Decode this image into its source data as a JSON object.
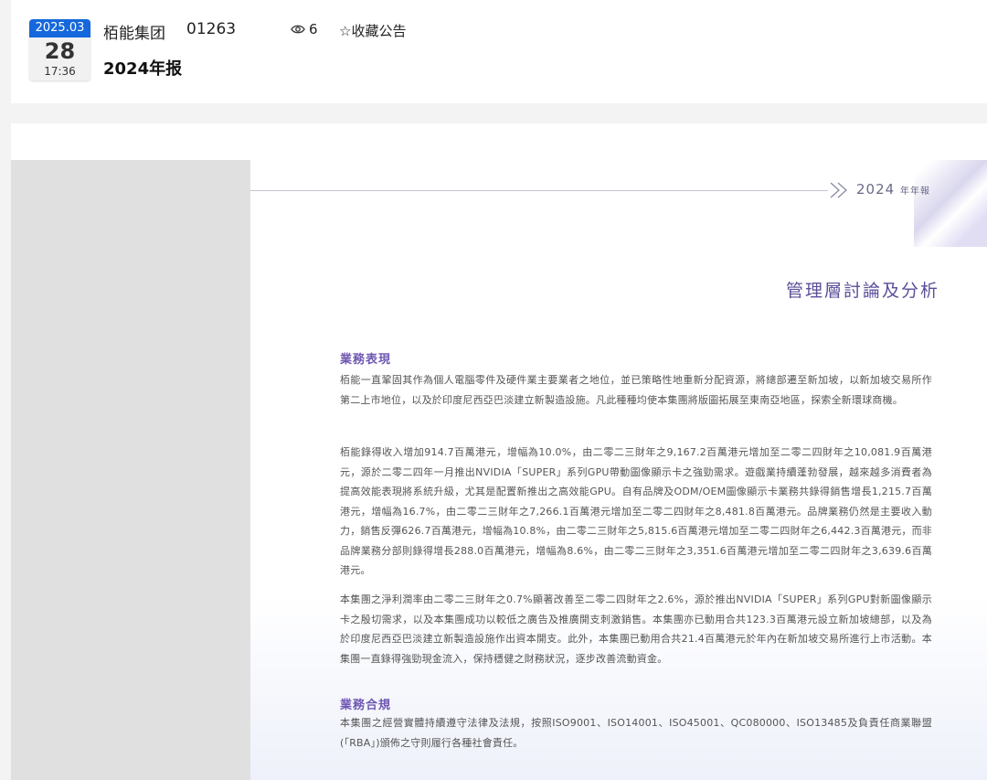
{
  "header": {
    "date_month": "2025.03",
    "date_day": "28",
    "date_time": "17:36",
    "company": "栢能集团",
    "stock_code": "01263",
    "views": "6",
    "favorite_label": "☆收藏公告",
    "title": "2024年报"
  },
  "document": {
    "year": "2024",
    "report_label": "年年報",
    "section_title": "管理層討論及分析",
    "heading1": "業務表現",
    "para1": "栢能一直鞏固其作為個人電腦零件及硬件業主要業者之地位，並已策略性地重新分配資源，將總部遷至新加坡，以新加坡交易所作第二上市地位，以及於印度尼西亞巴淡建立新製造設施。凡此種種均使本集團將版圖拓展至東南亞地區，探索全新環球商機。",
    "para2": "栢能錄得收入增加914.7百萬港元，增幅為10.0%，由二零二三財年之9,167.2百萬港元增加至二零二四財年之10,081.9百萬港元，源於二零二四年一月推出NVIDIA「SUPER」系列GPU帶動圖像顯示卡之強勁需求。遊戲業持續蓬勃發展，越來越多消費者為提高效能表現將系統升級，尤其是配置新推出之高效能GPU。自有品牌及ODM/OEM圖像顯示卡業務共錄得銷售增長1,215.7百萬港元，增幅為16.7%，由二零二三財年之7,266.1百萬港元增加至二零二四財年之8,481.8百萬港元。品牌業務仍然是主要收入動力，銷售反彈626.7百萬港元，增幅為10.8%，由二零二三財年之5,815.6百萬港元增加至二零二四財年之6,442.3百萬港元，而非品牌業務分部則錄得增長288.0百萬港元，增幅為8.6%，由二零二三財年之3,351.6百萬港元增加至二零二四財年之3,639.6百萬港元。",
    "para3": "本集團之淨利潤率由二零二三財年之0.7%顯著改善至二零二四財年之2.6%，源於推出NVIDIA「SUPER」系列GPU對新圖像顯示卡之殷切需求，以及本集團成功以較低之廣告及推廣開支刺激銷售。本集團亦已動用合共123.3百萬港元設立新加坡總部，以及為於印度尼西亞巴淡建立新製造設施作出資本開支。此外，本集團已動用合共21.4百萬港元於年內在新加坡交易所進行上市活動。本集團一直錄得強勁現金流入，保持穩健之財務狀況，逐步改善流動資金。",
    "heading2": "業務合規",
    "para4": "本集團之經營實體持續遵守法律及法規，按照ISO9001、ISO14001、ISO45001、QC080000、ISO13485及負責任商業聯盟(「RBA」)頒佈之守則履行各種社會責任。"
  }
}
